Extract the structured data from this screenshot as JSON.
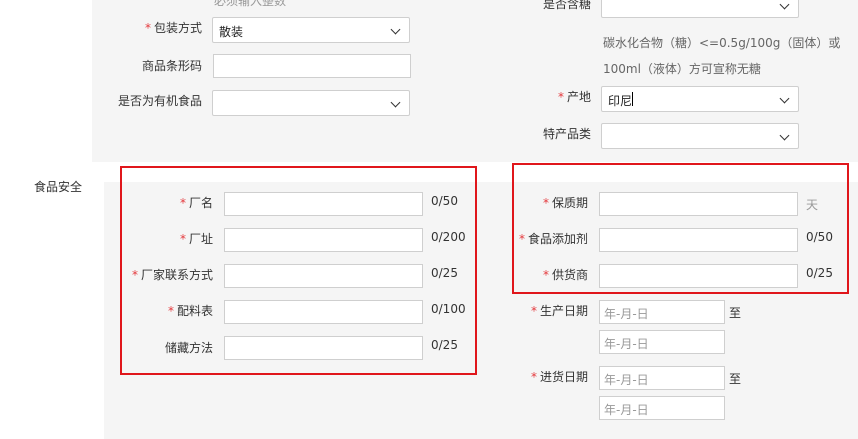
{
  "top": {
    "overflow_hint": "必须输入整数",
    "packing": {
      "label": "包装方式",
      "value": "散装"
    },
    "barcode": {
      "label": "商品条形码",
      "value": ""
    },
    "organic": {
      "label": "是否为有机食品",
      "value": ""
    },
    "sugar": {
      "label": "是否含糖",
      "value": ""
    },
    "sugar_hint_1": "碳水化合物（糖）<=0.5g/100g（固体）或",
    "sugar_hint_2": "100ml（液体）方可宣称无糖",
    "origin": {
      "label": "产地",
      "value": "印尼"
    },
    "specialty": {
      "label": "特产品类",
      "value": ""
    }
  },
  "food_safety": {
    "section_label": "食品安全",
    "left": [
      {
        "label": "厂名",
        "count": "0/50",
        "required": true
      },
      {
        "label": "厂址",
        "count": "0/200",
        "required": true
      },
      {
        "label": "厂家联系方式",
        "count": "0/25",
        "required": true
      },
      {
        "label": "配料表",
        "count": "0/100",
        "required": true
      },
      {
        "label": "储藏方法",
        "count": "0/25",
        "required": false
      }
    ],
    "shelf_life": {
      "label": "保质期",
      "unit": "天"
    },
    "additive": {
      "label": "食品添加剂",
      "count": "0/50"
    },
    "supplier": {
      "label": "供货商",
      "count": "0/25"
    },
    "production_date": {
      "label": "生产日期",
      "start_placeholder": "年-月-日",
      "to": "至",
      "end_placeholder": "年-月-日"
    },
    "purchase_date": {
      "label": "进货日期",
      "start_placeholder": "年-月-日",
      "to": "至",
      "end_placeholder": "年-月-日"
    }
  },
  "colors": {
    "panel": "#f5f5f5",
    "required": "#e4393c",
    "highlight_box": "#e0161b"
  }
}
